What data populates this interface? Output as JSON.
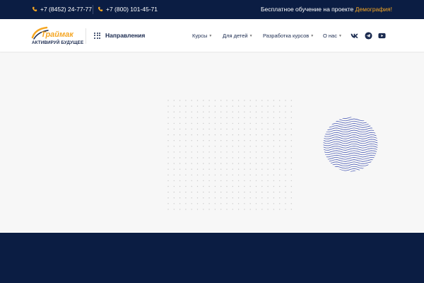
{
  "topbar": {
    "phone1": "+7 (8452) 24-77-77",
    "phone2": "+7 (800) 101-45-71",
    "promo_text": "Бесплатное обучение на проекте",
    "promo_highlight": "Демография!"
  },
  "header": {
    "logo_text": "Траймак",
    "slogan": "АКТИВИРУЙ БУДУЩЕЕ",
    "directions_label": "Направления",
    "nav": [
      {
        "label": "Курсы"
      },
      {
        "label": "Для детей"
      },
      {
        "label": "Разработка курсов"
      },
      {
        "label": "О нас"
      }
    ],
    "social": [
      "vk-icon",
      "telegram-icon",
      "youtube-icon"
    ]
  },
  "colors": {
    "navy": "#0b1d43",
    "accent": "#f5a623",
    "wave": "#3d4fb0"
  }
}
